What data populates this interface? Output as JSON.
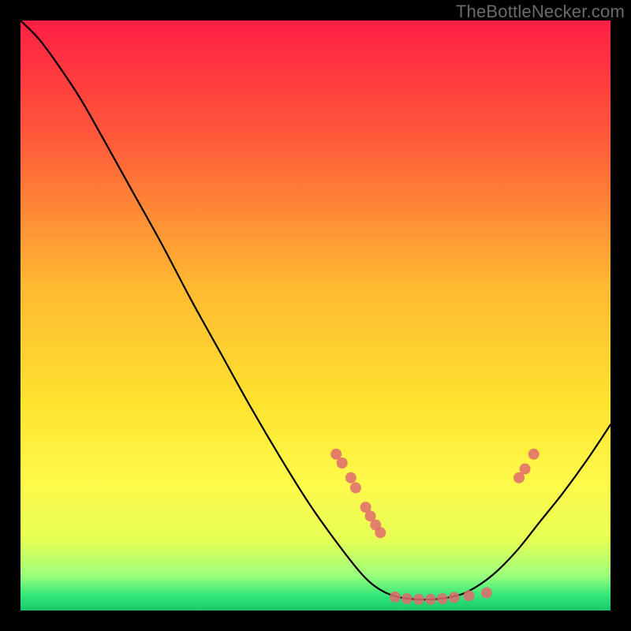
{
  "watermark": "TheBottleNecker.com",
  "chart_data": {
    "type": "line",
    "title": "",
    "xlabel": "",
    "ylabel": "",
    "xlim": [
      0,
      100
    ],
    "ylim": [
      0,
      100
    ],
    "gradient_stops": [
      {
        "offset": 0.0,
        "color": "#ff1f44"
      },
      {
        "offset": 0.2,
        "color": "#ff5a3a"
      },
      {
        "offset": 0.45,
        "color": "#ffb932"
      },
      {
        "offset": 0.65,
        "color": "#ffe330"
      },
      {
        "offset": 0.78,
        "color": "#fff94a"
      },
      {
        "offset": 0.88,
        "color": "#e7ff55"
      },
      {
        "offset": 0.94,
        "color": "#9dff7c"
      },
      {
        "offset": 0.975,
        "color": "#34e77a"
      },
      {
        "offset": 1.0,
        "color": "#18c96a"
      }
    ],
    "curve": [
      {
        "x": 0.0,
        "y": 100.0
      },
      {
        "x": 3.0,
        "y": 97.0
      },
      {
        "x": 6.0,
        "y": 93.0
      },
      {
        "x": 10.0,
        "y": 87.0
      },
      {
        "x": 14.0,
        "y": 80.0
      },
      {
        "x": 19.0,
        "y": 71.0
      },
      {
        "x": 24.0,
        "y": 62.0
      },
      {
        "x": 29.0,
        "y": 52.5
      },
      {
        "x": 34.0,
        "y": 43.5
      },
      {
        "x": 39.0,
        "y": 34.5
      },
      {
        "x": 44.0,
        "y": 26.0
      },
      {
        "x": 49.0,
        "y": 18.0
      },
      {
        "x": 54.0,
        "y": 11.0
      },
      {
        "x": 58.0,
        "y": 6.0
      },
      {
        "x": 61.0,
        "y": 3.5
      },
      {
        "x": 64.0,
        "y": 2.3
      },
      {
        "x": 67.0,
        "y": 1.9
      },
      {
        "x": 70.0,
        "y": 1.9
      },
      {
        "x": 73.0,
        "y": 2.3
      },
      {
        "x": 76.0,
        "y": 3.3
      },
      {
        "x": 80.0,
        "y": 6.0
      },
      {
        "x": 84.0,
        "y": 10.0
      },
      {
        "x": 88.0,
        "y": 15.0
      },
      {
        "x": 92.0,
        "y": 20.0
      },
      {
        "x": 96.0,
        "y": 25.5
      },
      {
        "x": 100.0,
        "y": 31.5
      }
    ],
    "markers": [
      {
        "x": 53.5,
        "y": 26.5
      },
      {
        "x": 54.5,
        "y": 25.0
      },
      {
        "x": 56.0,
        "y": 22.5
      },
      {
        "x": 56.8,
        "y": 20.8
      },
      {
        "x": 58.5,
        "y": 17.5
      },
      {
        "x": 59.3,
        "y": 16.0
      },
      {
        "x": 60.2,
        "y": 14.5
      },
      {
        "x": 61.0,
        "y": 13.2
      },
      {
        "x": 63.5,
        "y": 2.3
      },
      {
        "x": 65.5,
        "y": 2.0
      },
      {
        "x": 67.5,
        "y": 1.9
      },
      {
        "x": 69.5,
        "y": 1.9
      },
      {
        "x": 71.5,
        "y": 2.0
      },
      {
        "x": 73.5,
        "y": 2.2
      },
      {
        "x": 76.0,
        "y": 2.5
      },
      {
        "x": 79.0,
        "y": 3.0
      },
      {
        "x": 84.5,
        "y": 22.5
      },
      {
        "x": 85.5,
        "y": 24.0
      },
      {
        "x": 87.0,
        "y": 26.5
      }
    ]
  }
}
